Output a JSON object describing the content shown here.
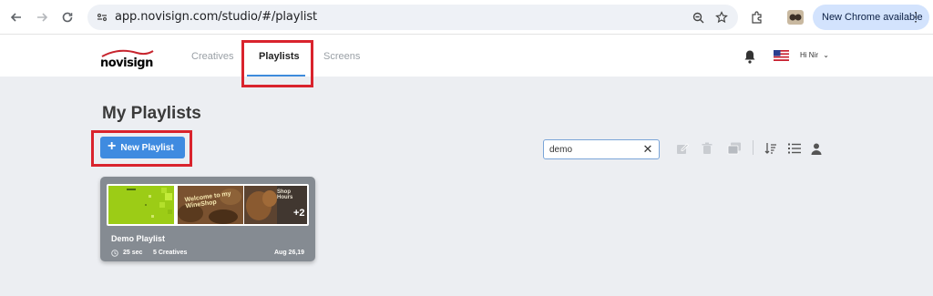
{
  "browser": {
    "url": "app.novisign.com/studio/#/playlist",
    "update_label": "New Chrome available"
  },
  "app": {
    "logo_text": "novisign",
    "tabs": [
      {
        "label": "Creatives",
        "active": false
      },
      {
        "label": "Playlists",
        "active": true
      },
      {
        "label": "Screens",
        "active": false
      }
    ],
    "user_greeting": "Hi Nir"
  },
  "main": {
    "page_title": "My Playlists",
    "new_playlist_label": "New Playlist",
    "search": {
      "value": "demo",
      "placeholder": ""
    },
    "toolbar_icons": [
      "edit-icon",
      "trash-icon",
      "duplicate-icon",
      "sort-icon",
      "list-view-icon",
      "user-filter-icon"
    ]
  },
  "playlists": [
    {
      "name": "Demo Playlist",
      "duration": "25 sec",
      "creatives": "5 Creatives",
      "date": "Aug 26,19",
      "thumb_caption": "Welcome to my WineShop",
      "thumb_caption_2": "Shop Hours",
      "more_count": "+2"
    }
  ],
  "colors": {
    "accent": "#3f8be0",
    "highlight": "#d9232d",
    "brand": "#c7252e"
  }
}
